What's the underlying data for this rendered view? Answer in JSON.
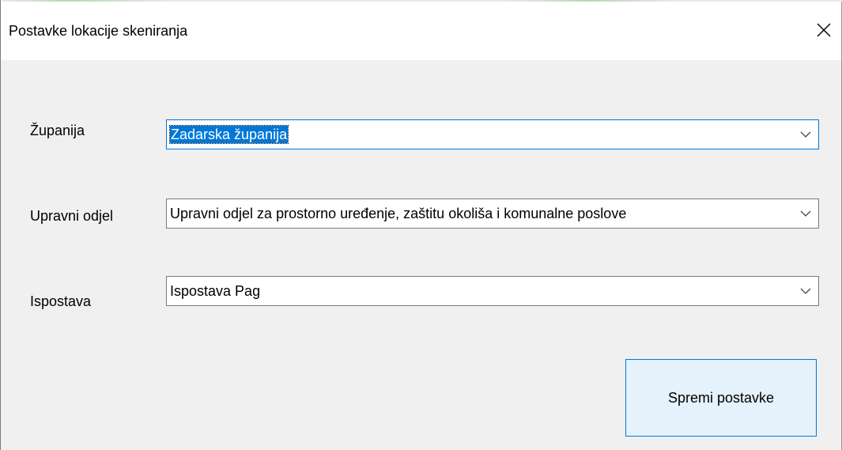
{
  "window": {
    "title": "Postavke lokacije skeniranja"
  },
  "form": {
    "zupanija": {
      "label": "Županija",
      "value": "Zadarska županija"
    },
    "upravni_odjel": {
      "label": "Upravni odjel",
      "value": "Upravni odjel za prostorno uređenje, zaštitu okoliša i komunalne poslove"
    },
    "ispostava": {
      "label": "Ispostava",
      "value": "Ispostava Pag"
    }
  },
  "actions": {
    "save_label": "Spremi postavke"
  },
  "icons": {
    "close": "close-icon",
    "dropdown": "chevron-down-icon"
  },
  "colors": {
    "accent": "#0078d7",
    "button_bg": "#e5f1fb",
    "window_bg": "#f0f0f0"
  }
}
